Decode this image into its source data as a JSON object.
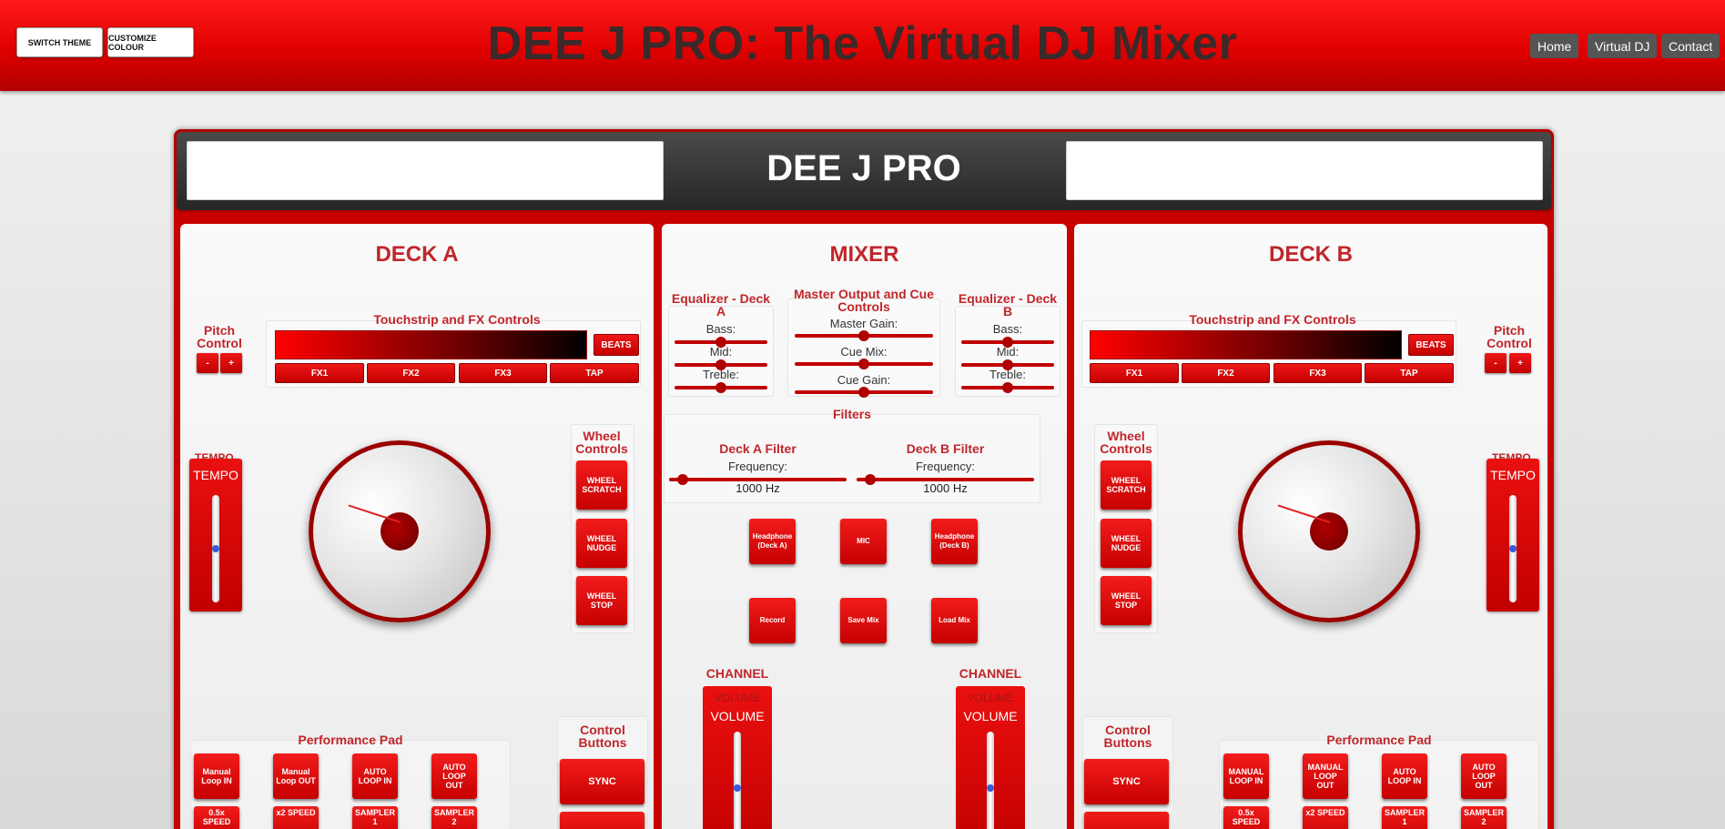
{
  "top": {
    "switch_theme": "SWITCH THEME",
    "customize_colour": "CUSTOMIZE COLOUR",
    "site_title": "DEE J PRO: The Virtual DJ Mixer",
    "nav": [
      "Home",
      "Virtual DJ",
      "Contact"
    ]
  },
  "header": {
    "brand": "DEE J PRO"
  },
  "deckA": {
    "title": "DECK A",
    "pitch_label": "Pitch Control",
    "minus": "-",
    "plus": "+",
    "touchstrip_label": "Touchstrip and FX Controls",
    "beats": "BEATS",
    "fx": [
      "FX1",
      "FX2",
      "FX3",
      "TAP"
    ],
    "tempo_ghost": "TEMPO",
    "tempo": "TEMPO",
    "tempo_level": 0.5,
    "wheel_label": "Wheel Controls",
    "wheel_buttons": [
      "WHEEL SCRATCH",
      "WHEEL NUDGE",
      "WHEEL STOP"
    ],
    "pad_label": "Performance Pad",
    "pads": [
      "Manual Loop IN",
      "Manual Loop OUT",
      "AUTO LOOP IN",
      "AUTO LOOP OUT",
      "0.5x SPEED",
      "x2 SPEED",
      "SAMPLER 1",
      "SAMPLER 2"
    ],
    "control_label": "Control Buttons",
    "sync": "SYNC"
  },
  "deckB": {
    "title": "DECK B",
    "pitch_label": "Pitch Control",
    "minus": "-",
    "plus": "+",
    "touchstrip_label": "Touchstrip and FX Controls",
    "beats": "BEATS",
    "fx": [
      "FX1",
      "FX2",
      "FX3",
      "TAP"
    ],
    "tempo_ghost": "TEMPO",
    "tempo": "TEMPO",
    "tempo_level": 0.5,
    "wheel_label": "Wheel Controls",
    "wheel_buttons": [
      "WHEEL SCRATCH",
      "WHEEL NUDGE",
      "WHEEL STOP"
    ],
    "pad_label": "Performance Pad",
    "pads": [
      "MANUAL LOOP IN",
      "MANUAL LOOP OUT",
      "AUTO LOOP IN",
      "AUTO LOOP OUT",
      "0.5x SPEED",
      "x2 SPEED",
      "SAMPLER 1",
      "SAMPLER 2"
    ],
    "control_label": "Control Buttons",
    "sync": "SYNC"
  },
  "mixer": {
    "title": "MIXER",
    "eq_a": {
      "label": "Equalizer - Deck A",
      "bass": "Bass:",
      "mid": "Mid:",
      "treble": "Treble:",
      "levels": [
        0.5,
        0.5,
        0.5
      ]
    },
    "master": {
      "label": "Master Output and Cue Controls",
      "gain": "Master Gain:",
      "cue_mix": "Cue Mix:",
      "cue_gain": "Cue Gain:",
      "levels": [
        0.5,
        0.5,
        0.5
      ]
    },
    "eq_b": {
      "label": "Equalizer - Deck B",
      "bass": "Bass:",
      "mid": "Mid:",
      "treble": "Treble:",
      "levels": [
        0.5,
        0.5,
        0.5
      ]
    },
    "filters": {
      "label": "Filters",
      "a_label": "Deck A Filter",
      "a_freq_label": "Frequency:",
      "a_value": "1000 Hz",
      "a_level": 0.05,
      "b_label": "Deck B Filter",
      "b_freq_label": "Frequency:",
      "b_value": "1000 Hz",
      "b_level": 0.05
    },
    "buttons_row1": [
      "Headphone (Deck A)",
      "MIC",
      "Headphone (Deck B)"
    ],
    "buttons_row2": [
      "Record",
      "Save Mix",
      "Load Mix"
    ],
    "channel_a": {
      "label": "CHANNEL A",
      "ghost": "VOLUME",
      "volume": "VOLUME",
      "level": 0.5
    },
    "channel_b": {
      "label": "CHANNEL B",
      "ghost": "VOLUME",
      "volume": "VOLUME",
      "level": 0.5
    }
  }
}
